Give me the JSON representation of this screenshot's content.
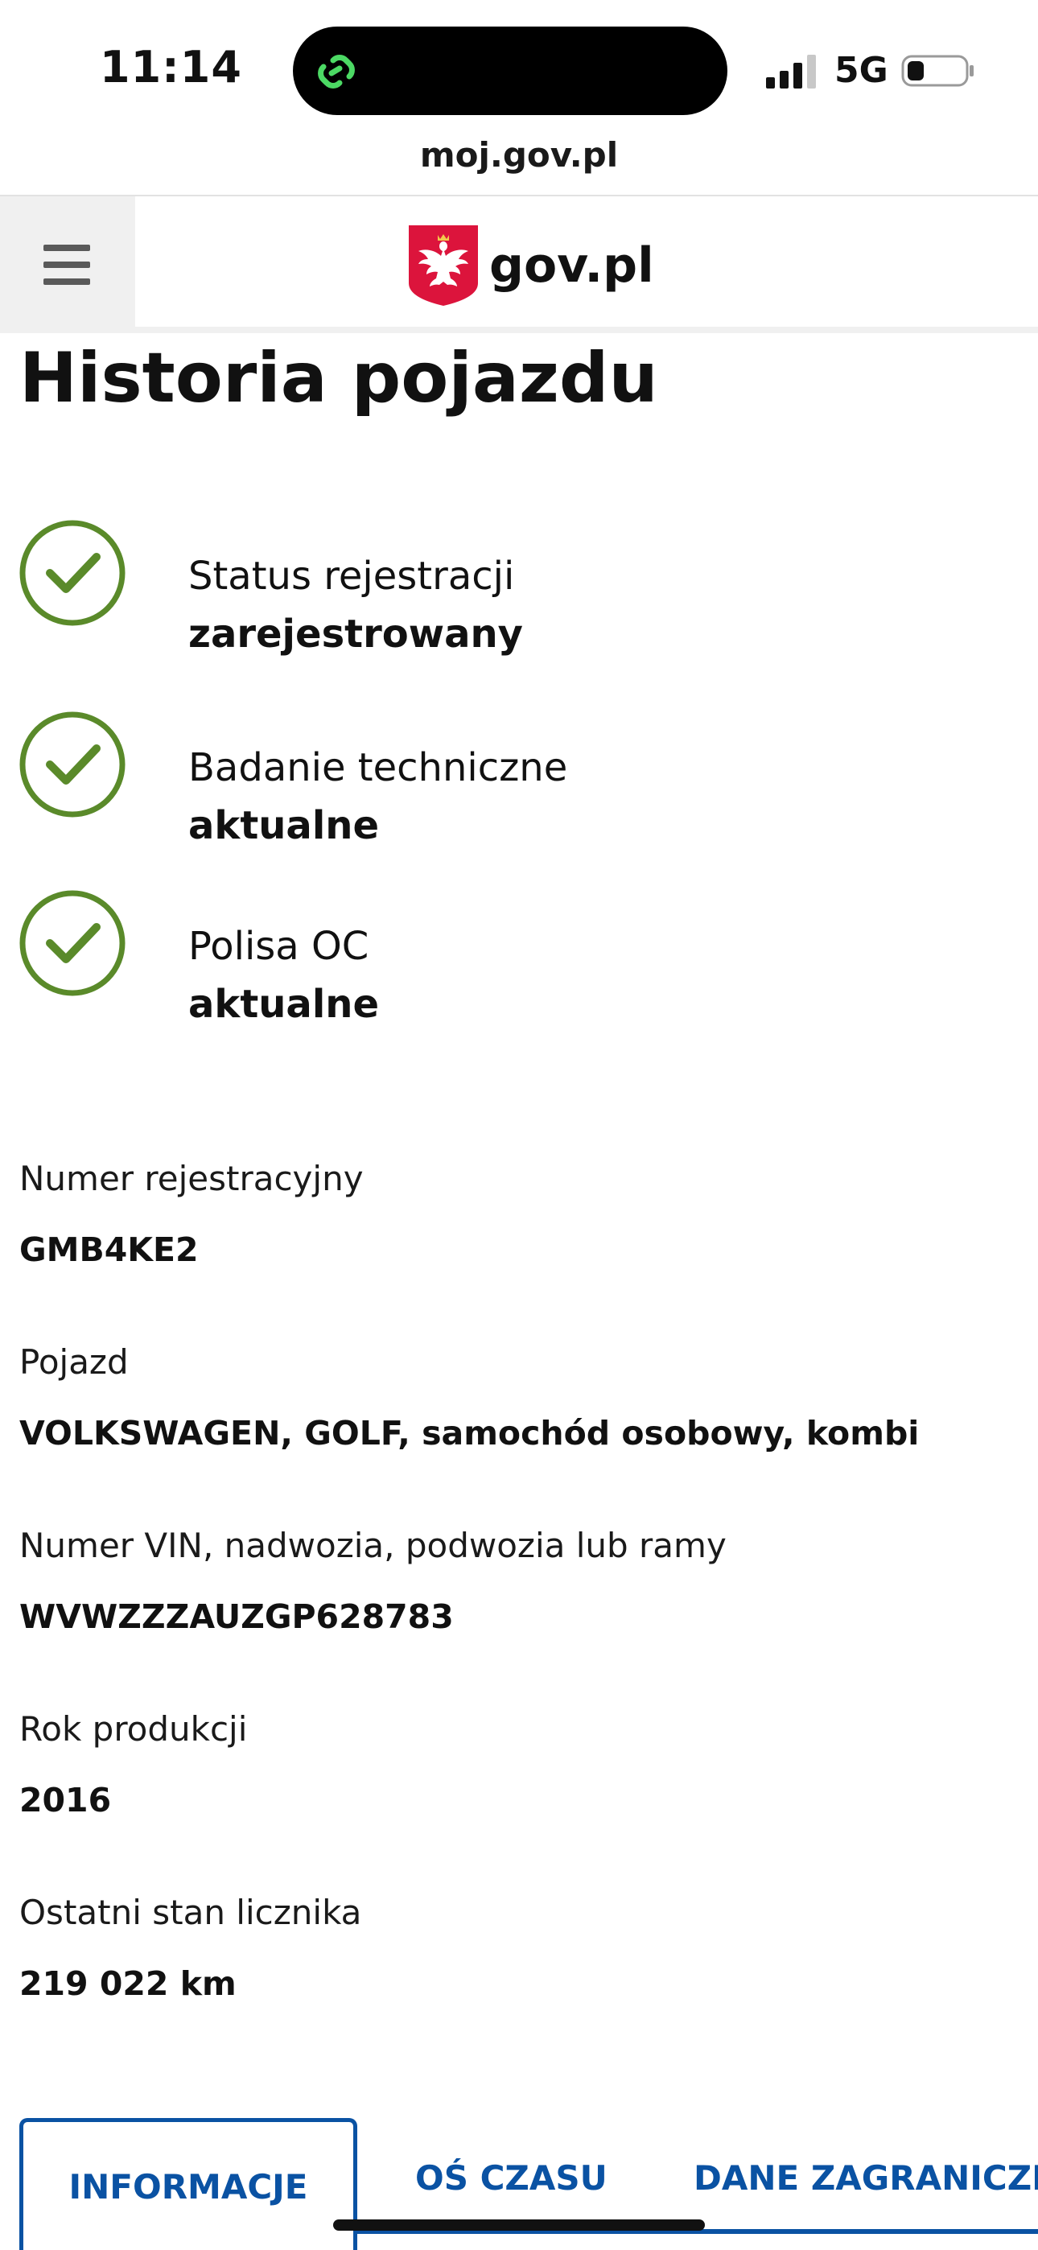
{
  "status_bar": {
    "time": "11:14",
    "network": "5G"
  },
  "browser": {
    "url": "moj.gov.pl"
  },
  "header": {
    "logo_text": "gov.pl"
  },
  "page": {
    "title": "Historia pojazdu"
  },
  "status_items": [
    {
      "label": "Status rejestracji",
      "value": "zarejestrowany"
    },
    {
      "label": "Badanie techniczne",
      "value": "aktualne"
    },
    {
      "label": "Polisa OC",
      "value": "aktualne"
    }
  ],
  "details": [
    {
      "label": "Numer rejestracyjny",
      "value": "GMB4KE2"
    },
    {
      "label": "Pojazd",
      "value": "VOLKSWAGEN, GOLF, samochód osobowy, kombi"
    },
    {
      "label": "Numer VIN, nadwozia, podwozia lub ramy",
      "value": "WVWZZZAUZGP628783"
    },
    {
      "label": "Rok produkcji",
      "value": "2016"
    },
    {
      "label": "Ostatni stan licznika",
      "value": "219 022 km"
    }
  ],
  "tabs": [
    {
      "label": "INFORMACJE",
      "active": true
    },
    {
      "label": "OŚ CZASU",
      "active": false
    },
    {
      "label": "DANE ZAGRANICZN",
      "active": false
    }
  ],
  "colors": {
    "check_green": "#5a8a2a",
    "link_blue": "#0a52a3",
    "emblem_red": "#dc143c"
  }
}
